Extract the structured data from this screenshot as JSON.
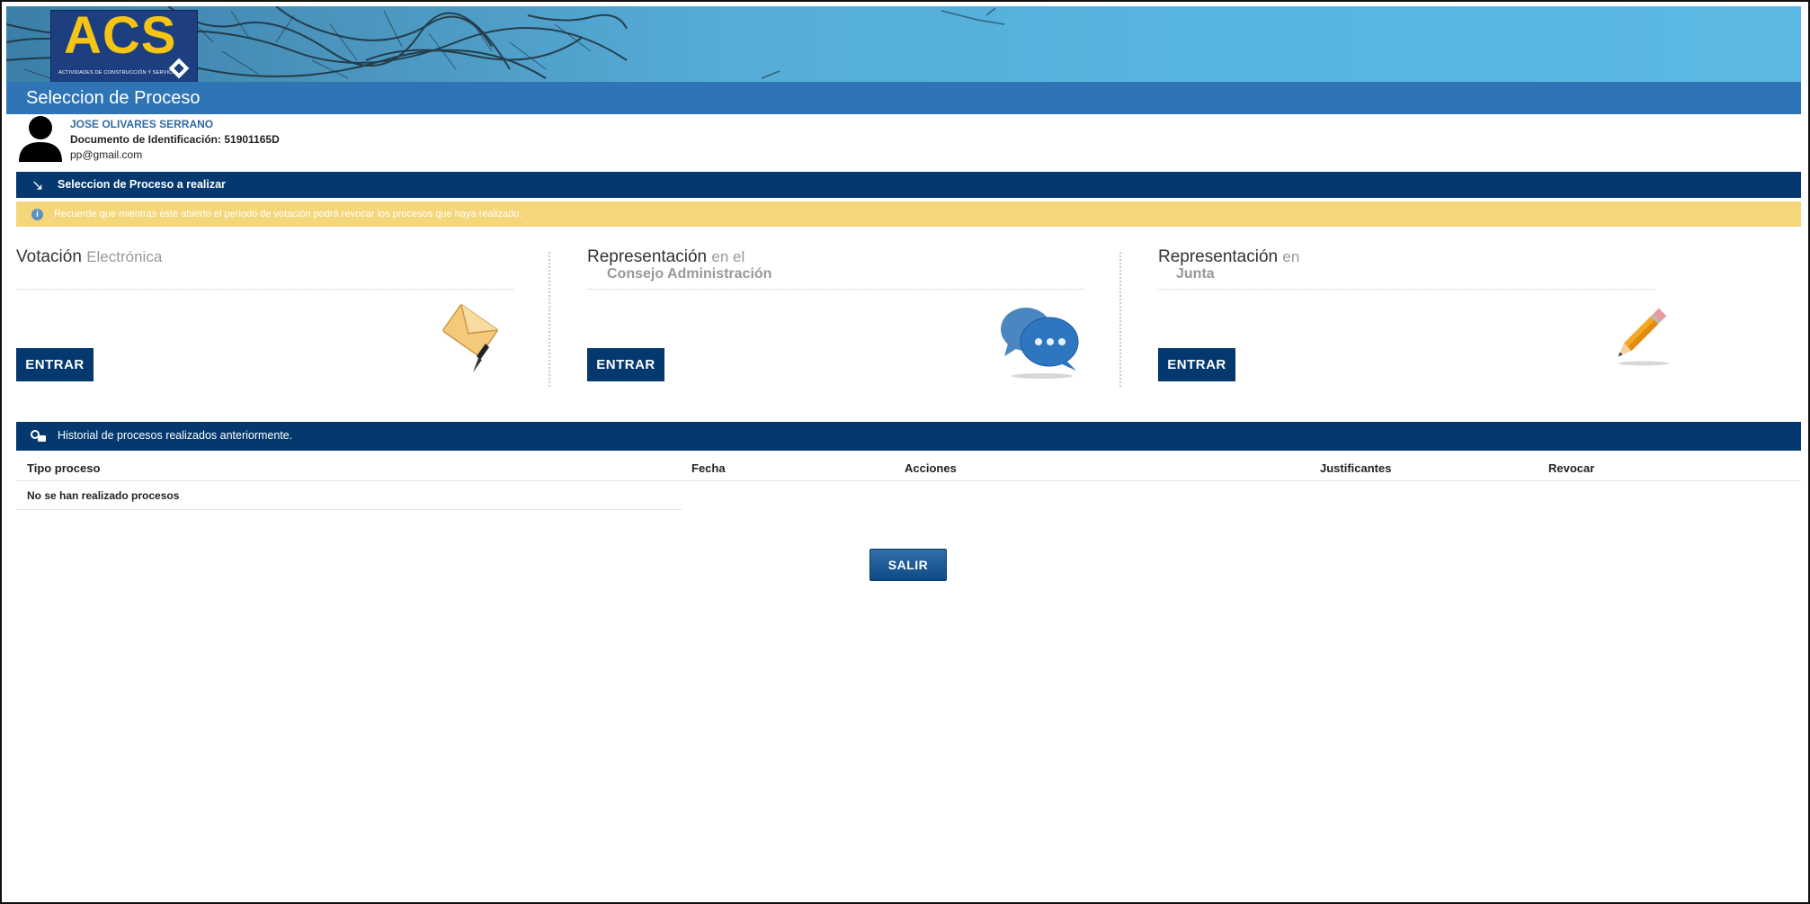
{
  "header": {
    "logo_text": "ACS",
    "logo_subtitle": "ACTIVIDADES DE CONSTRUCCIÓN Y SERVICIOS",
    "page_title": "Seleccion de Proceso"
  },
  "user": {
    "name": "JOSE OLIVARES SERRANO",
    "document": "Documento de Identificación: 51901165D",
    "email": "pp@gmail.com"
  },
  "selection_section": {
    "title": "Seleccion de Proceso a realizar",
    "notice": "Recuerde que mientras esté abierto el periodo de votación podrá revocar los procesos que haya realizado."
  },
  "processes": [
    {
      "title_main": "Votación",
      "title_light": "Electrónica",
      "title_second": "",
      "button": "ENTRAR",
      "icon": "envelope-icon"
    },
    {
      "title_main": "Representación",
      "title_light": "en el",
      "title_second": "Consejo Administración",
      "button": "ENTRAR",
      "icon": "chat-bubbles-icon"
    },
    {
      "title_main": "Representación",
      "title_light": "en",
      "title_second": "Junta",
      "button": "ENTRAR",
      "icon": "pencil-icon"
    }
  ],
  "history": {
    "title": "Historial de procesos realizados anteriormente.",
    "columns": [
      "Tipo proceso",
      "Fecha",
      "Acciones",
      "Justificantes",
      "Revocar"
    ],
    "empty_message": "No se han realizado procesos"
  },
  "footer": {
    "exit_label": "SALIR"
  },
  "colors": {
    "primary": "#04386e",
    "title_bar": "#2f74b5",
    "notice": "#f6d67a",
    "logo_yellow": "#f6c414"
  }
}
